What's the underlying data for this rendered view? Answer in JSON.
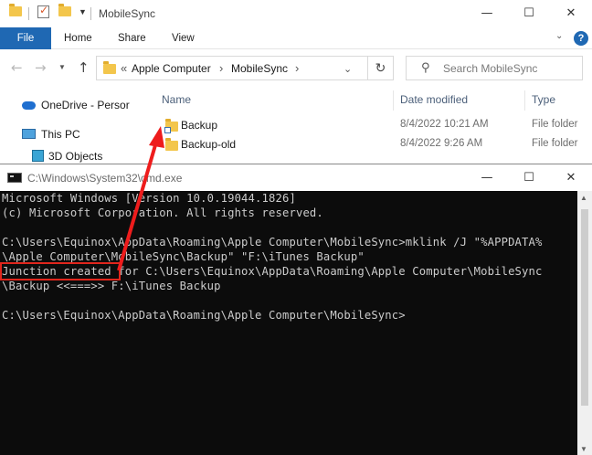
{
  "explorer": {
    "title": "MobileSync",
    "ribbon_tabs": [
      "File",
      "Home",
      "Share",
      "View"
    ],
    "help_label": "?",
    "breadcrumb": {
      "overflow": "«",
      "parts": [
        "Apple Computer",
        "MobileSync"
      ],
      "separator": "›"
    },
    "search_placeholder": "Search MobileSync",
    "nav_pane": [
      {
        "label": "OneDrive - Persor",
        "icon": "cloud-icon"
      },
      {
        "label": "This PC",
        "icon": "computer-icon"
      },
      {
        "label": "3D Objects",
        "icon": "cube-icon"
      }
    ],
    "columns": {
      "name": "Name",
      "date": "Date modified",
      "type": "Type"
    },
    "files": [
      {
        "name": "Backup",
        "date": "8/4/2022 10:21 AM",
        "type": "File folder",
        "is_junction": true
      },
      {
        "name": "Backup-old",
        "date": "8/4/2022 9:26 AM",
        "type": "File folder",
        "is_junction": false
      }
    ],
    "accent": "#1f68b3"
  },
  "cmd": {
    "title": "C:\\Windows\\System32\\cmd.exe",
    "lines": [
      "Microsoft Windows [Version 10.0.19044.1826]",
      "(c) Microsoft Corporation. All rights reserved.",
      "",
      "C:\\Users\\Equinox\\AppData\\Roaming\\Apple Computer\\MobileSync>mklink /J \"%APPDATA%",
      "\\Apple Computer\\MobileSync\\Backup\" \"F:\\iTunes Backup\"",
      "Junction created for C:\\Users\\Equinox\\AppData\\Roaming\\Apple Computer\\MobileSync",
      "\\Backup <<===>> F:\\iTunes Backup",
      "",
      "C:\\Users\\Equinox\\AppData\\Roaming\\Apple Computer\\MobileSync>"
    ],
    "highlight_color": "#e1261c"
  }
}
